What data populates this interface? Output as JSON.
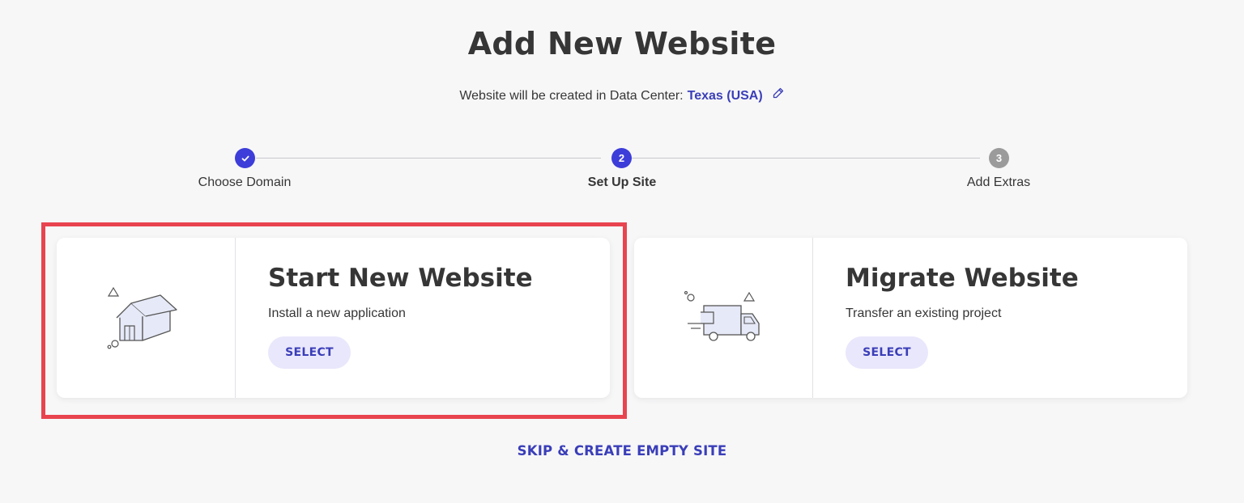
{
  "page": {
    "title": "Add New Website",
    "datacenter_prefix": "Website will be created in Data Center:",
    "datacenter_value": "Texas (USA)"
  },
  "stepper": {
    "steps": [
      {
        "number": "",
        "label": "Choose Domain",
        "state": "done",
        "icon": "check-icon"
      },
      {
        "number": "2",
        "label": "Set Up Site",
        "state": "active"
      },
      {
        "number": "3",
        "label": "Add Extras",
        "state": "pending"
      }
    ]
  },
  "cards": [
    {
      "title": "Start New Website",
      "description": "Install a new application",
      "button": "SELECT",
      "illustration": "house-icon",
      "highlighted": true
    },
    {
      "title": "Migrate Website",
      "description": "Transfer an existing project",
      "button": "SELECT",
      "illustration": "delivery-truck-icon",
      "highlighted": false
    }
  ],
  "skip_link": "SKIP & CREATE EMPTY SITE",
  "colors": {
    "accent": "#3d3dd9",
    "link": "#3a3eb8",
    "highlight_frame": "#e8444f",
    "button_bg": "#e9e7fb",
    "background": "#f7f7f8"
  }
}
